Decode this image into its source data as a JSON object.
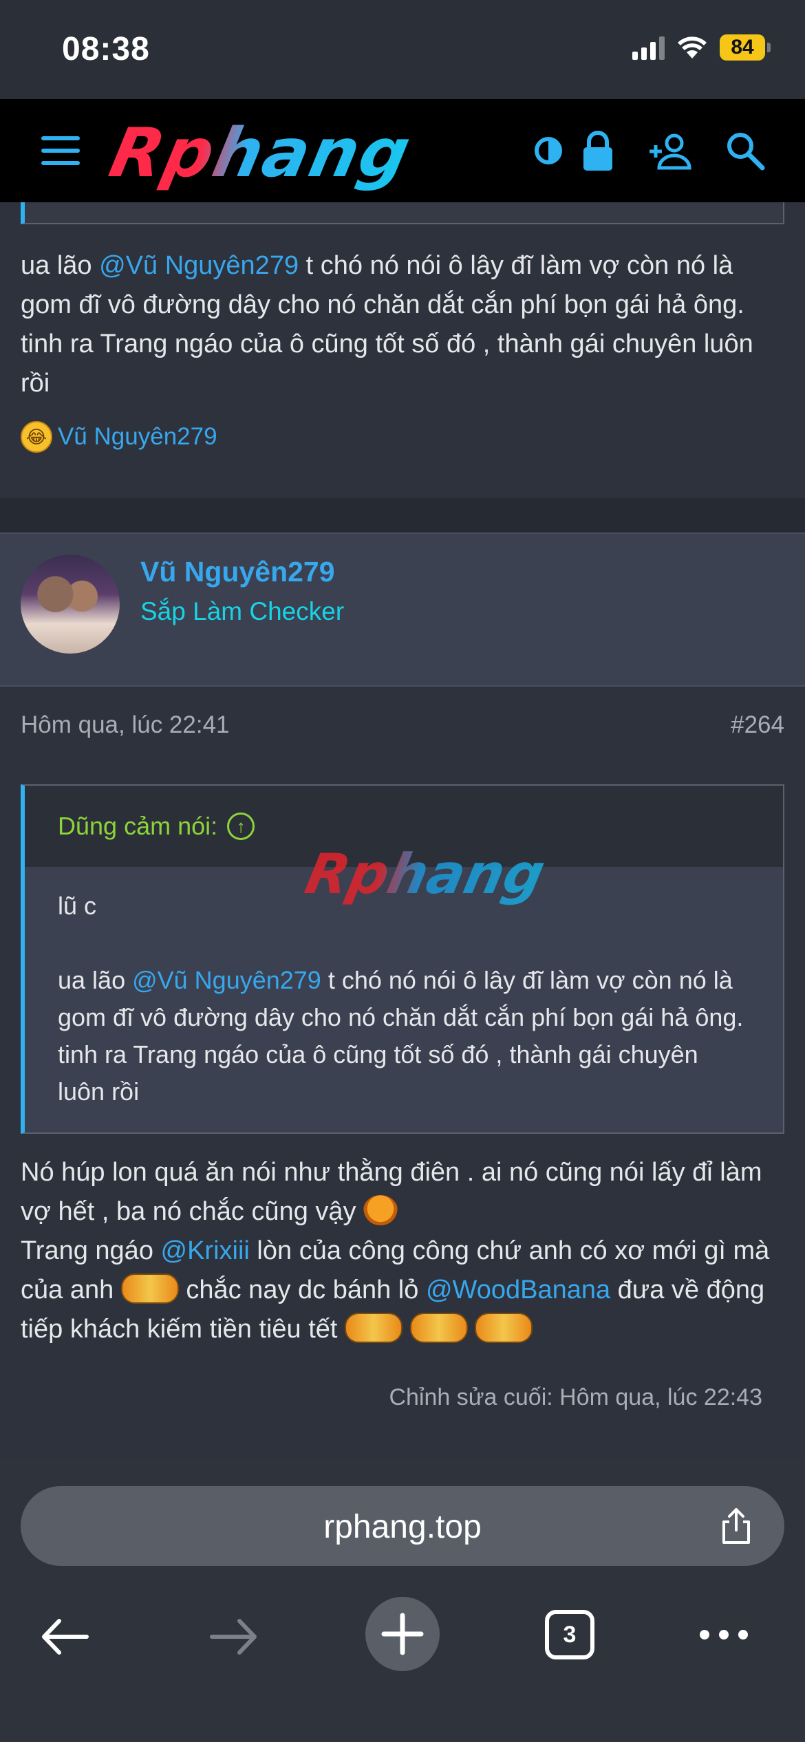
{
  "status_bar": {
    "time": "08:38",
    "battery": "84"
  },
  "header": {
    "logo": "Rphang"
  },
  "post1": {
    "mention": "@Vũ Nguyên279",
    "text_before": "ua lão ",
    "text_after": " t chó nó nói ô lây đĩ làm vợ còn nó là gom đĩ vô đường dây cho nó chăn dắt cắn phí bọn gái hả ông. tinh ra Trang ngáo của ô cũng tốt số đó , thành gái chuyên luôn rồi",
    "reaction_user": "Vũ Nguyên279"
  },
  "user": {
    "name": "Vũ Nguyên279",
    "title": "Sắp Làm Checker"
  },
  "post2": {
    "date": "Hôm qua, lúc 22:41",
    "number": "#264",
    "quote": {
      "author": "Dũng cảm nói:",
      "watermark": "Rphang",
      "line1": "lũ c",
      "text_before": "ua lão ",
      "mention": "@Vũ Nguyên279",
      "text_after": " t chó nó nói ô lây đĩ làm vợ còn nó là gom đĩ vô đường dây cho nó chăn dắt cắn phí bọn gái hả ông. tinh ra Trang ngáo của ô cũng tốt số đó , thành gái chuyên luôn rồi"
    },
    "body": {
      "part1": "Nó húp lon quá ăn nói như thằng điên . ai nó cũng nói lấy đỉ làm vợ hết , ba nó chắc cũng vậy ",
      "part2": "Trang ngáo ",
      "mention1": "@Krixiii",
      "part3": " lòn của công công chứ anh có xơ mới gì mà của anh ",
      "part4": " chắc nay dc bánh lỏ ",
      "mention2": "@WoodBanana",
      "part5": " đưa về động tiếp khách kiếm tiền tiêu tết "
    },
    "edit_note": "Chỉnh sửa cuối: Hôm qua, lúc 22:43"
  },
  "browser": {
    "url": "rphang.top",
    "tab_count": "3"
  }
}
